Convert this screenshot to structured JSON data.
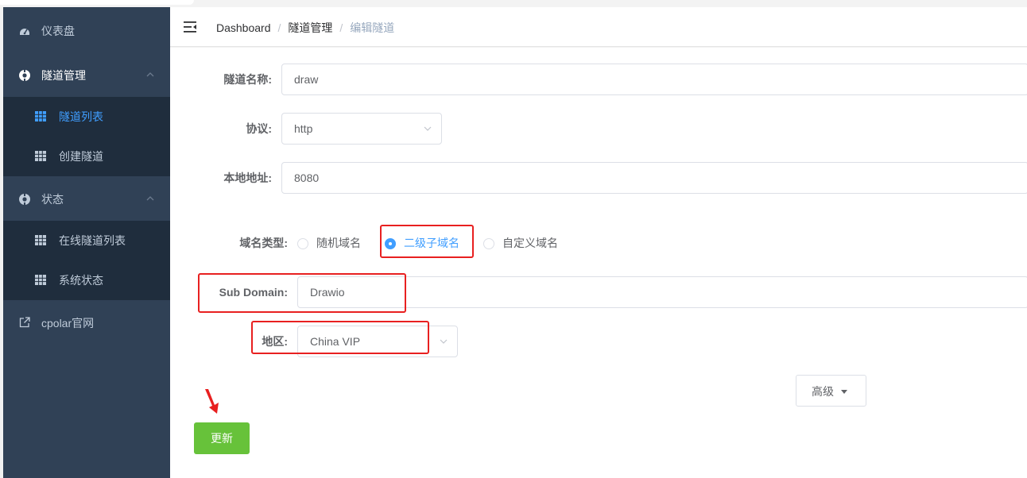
{
  "sidebar": {
    "items": [
      {
        "label": "仪表盘",
        "icon": "dashboard-gauge-icon"
      },
      {
        "label": "隧道管理",
        "icon": "tunnel-circle-icon",
        "expanded": true,
        "children": [
          {
            "label": "隧道列表",
            "icon": "grid-table-icon",
            "active": true
          },
          {
            "label": "创建隧道",
            "icon": "grid-table-icon"
          }
        ]
      },
      {
        "label": "状态",
        "icon": "status-circle-icon",
        "expanded": true,
        "children": [
          {
            "label": "在线隧道列表",
            "icon": "grid-table-icon"
          },
          {
            "label": "系统状态",
            "icon": "grid-table-icon"
          }
        ]
      },
      {
        "label": "cpolar官网",
        "icon": "external-link-icon"
      }
    ]
  },
  "header": {
    "breadcrumb": [
      "Dashboard",
      "隧道管理",
      "编辑隧道"
    ],
    "separator": "/"
  },
  "form": {
    "tunnel_name": {
      "label": "隧道名称:",
      "value": "draw"
    },
    "protocol": {
      "label": "协议:",
      "value": "http"
    },
    "local_address": {
      "label": "本地地址:",
      "value": "8080"
    },
    "domain_type": {
      "label": "域名类型:",
      "options": [
        "随机域名",
        "二级子域名",
        "自定义域名"
      ],
      "selected": "二级子域名"
    },
    "sub_domain": {
      "label": "Sub Domain:",
      "value": "Drawio"
    },
    "region": {
      "label": "地区:",
      "value": "China VIP"
    },
    "advanced_label": "高级",
    "update_label": "更新"
  },
  "colors": {
    "sidebar_bg": "#304156",
    "submenu_bg": "#1f2d3d",
    "active_blue": "#409eff",
    "update_green": "#67c23a",
    "annotation_red": "#e82020"
  }
}
